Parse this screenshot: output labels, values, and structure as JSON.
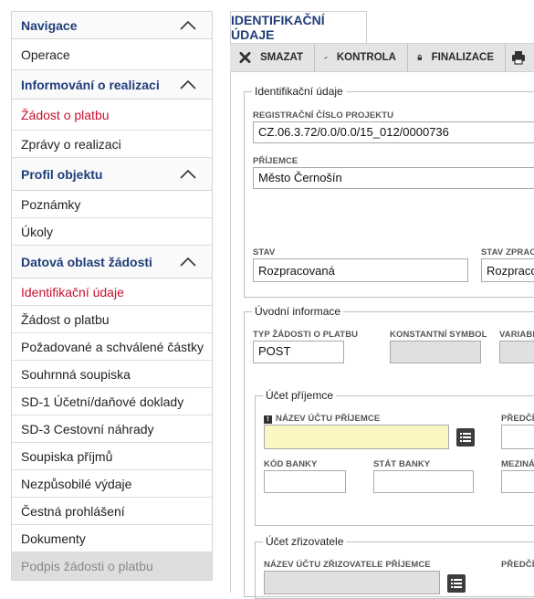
{
  "sidebar": {
    "sections": [
      {
        "title": "Navigace",
        "items": [
          {
            "label": "Operace"
          }
        ]
      },
      {
        "title": "Informování o realizaci",
        "items": [
          {
            "label": "Žádost o platbu"
          },
          {
            "label": "Zprávy o realizaci"
          }
        ]
      },
      {
        "title": "Profil objektu",
        "items": [
          {
            "label": "Poznámky"
          },
          {
            "label": "Úkoly"
          }
        ]
      },
      {
        "title": "Datová oblast žádosti",
        "items": [
          {
            "label": "Identifikační údaje"
          },
          {
            "label": "Žádost o platbu"
          },
          {
            "label": "Požadované a schválené částky"
          },
          {
            "label": "Souhrnná soupiska"
          },
          {
            "label": "SD-1 Účetní/daňové doklady"
          },
          {
            "label": "SD-3 Cestovní náhrady"
          },
          {
            "label": "Soupiska příjmů"
          },
          {
            "label": "Nezpůsobilé výdaje"
          },
          {
            "label": "Čestná prohlášení"
          },
          {
            "label": "Dokumenty"
          },
          {
            "label": "Podpis žádosti o platbu"
          }
        ]
      }
    ]
  },
  "main": {
    "tab_label": "IDENTIFIKAČNÍ ÚDAJE",
    "toolbar": {
      "delete": "SMAZAT",
      "check": "KONTROLA",
      "finalize": "FINALIZACE"
    },
    "ident": {
      "legend": "Identifikační údaje",
      "reg_label": "REGISTRAČNÍ ČÍSLO PROJEKTU",
      "reg_value": "CZ.06.3.72/0.0/0.0/15_012/0000736",
      "recipient_label": "PŘÍJEMCE",
      "recipient_value": "Město Černošín",
      "state_label": "STAV",
      "state_value": "Rozpracovaná",
      "state_proc_label": "STAV ZPRACO",
      "state_proc_value": "Rozpracov"
    },
    "intro": {
      "legend": "Úvodní informace",
      "type_label": "TYP ŽÁDOSTI O PLATBU",
      "type_value": "POST",
      "const_label": "KONSTANTNÍ SYMBOL",
      "var_label": "VARIABI"
    },
    "recipient_account": {
      "legend": "Účet příjemce",
      "required_mark": "!",
      "name_label": "NÁZEV ÚČTU PŘÍJEMCE",
      "prefix_label": "PŘEDČÍS",
      "bank_code_label": "KÓD BANKY",
      "bank_state_label": "STÁT BANKY",
      "intl_label": "MEZINÁ"
    },
    "founder_account": {
      "legend": "Účet zřizovatele",
      "name_label": "NÁZEV ÚČTU ZŘIZOVATELE PŘÍJEMCE",
      "prefix_label": "PŘEDČÍS"
    }
  },
  "colors": {
    "nav_heading": "#1f3d7a",
    "active_red": "#c8102e",
    "required_yellow": "#fbf7c2"
  }
}
